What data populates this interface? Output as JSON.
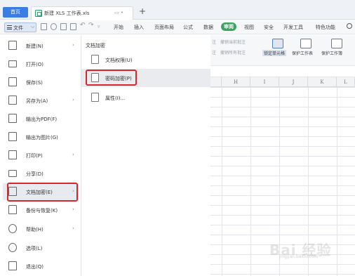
{
  "tabbar": {
    "home_label": "首页",
    "doc_title": "新建 XLS 工作表.xls",
    "tab_controls": "▭ •",
    "new_tab": "+"
  },
  "toolbar": {
    "file_label": "文件",
    "ribbon_tabs": [
      "开始",
      "插入",
      "页面布局",
      "公式",
      "数据",
      "审阅",
      "视图",
      "安全",
      "开发工具",
      "特色功能"
    ],
    "active_tab": "审阅"
  },
  "ribbon": {
    "small_1": "撤销当前批注",
    "small_2": "撤销所有批注",
    "edge_1": "注",
    "edge_2": "注",
    "lock_cell": "锁定单元格",
    "protect_sheet": "保护工作表",
    "protect_book": "保护工作簿"
  },
  "sheet": {
    "columns": [
      "H",
      "I",
      "J",
      "K",
      "L"
    ]
  },
  "menu": {
    "items": [
      {
        "label": "新建(N)",
        "arrow": "›"
      },
      {
        "label": "打开(O)",
        "arrow": ""
      },
      {
        "label": "保存(S)",
        "arrow": ""
      },
      {
        "label": "另存为(A)",
        "arrow": "›"
      },
      {
        "label": "输出为PDF(F)",
        "arrow": ""
      },
      {
        "label": "输出为图片(G)",
        "arrow": ""
      },
      {
        "label": "打印(P)",
        "arrow": "›"
      },
      {
        "label": "分享(D)",
        "arrow": ""
      },
      {
        "label": "文档加密(E)",
        "arrow": "›"
      },
      {
        "label": "备份与恢复(K)",
        "arrow": "›"
      },
      {
        "label": "帮助(H)",
        "arrow": "›"
      },
      {
        "label": "选项(L)",
        "arrow": ""
      },
      {
        "label": "退出(Q)",
        "arrow": ""
      }
    ]
  },
  "submenu": {
    "title": "文档加密",
    "items": [
      {
        "label": "文档权限(U)"
      },
      {
        "label": "密码加密(P)"
      },
      {
        "label": "属性(I)..."
      }
    ]
  },
  "watermark": {
    "text": "Bai 经验",
    "sub": "jingyan.baidu.com"
  },
  "colors": {
    "accent": "#3b7de0",
    "review_tab": "#3aa55f",
    "highlight_box": "#d8262b"
  }
}
